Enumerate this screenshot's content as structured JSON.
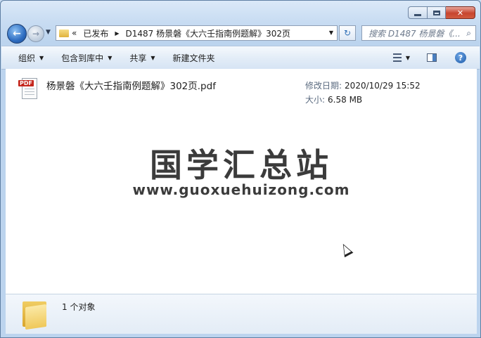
{
  "nav": {
    "breadcrumb": [
      "«",
      "已发布",
      "D1487 杨景磐《大六壬指南例题解》302页"
    ],
    "search_placeholder": "搜索 D1487 杨景磐《..."
  },
  "toolbar": {
    "organize": "组织",
    "include_in_library": "包含到库中",
    "share": "共享",
    "new_folder": "新建文件夹"
  },
  "file": {
    "name": "杨景磐《大六壬指南例题解》302页.pdf",
    "icon_tag": "PDF",
    "modified_label": "修改日期:",
    "modified_value": "2020/10/29 15:52",
    "size_label": "大小:",
    "size_value": "6.58 MB"
  },
  "watermark": {
    "title": "国学汇总站",
    "url": "www.guoxuehuizong.com"
  },
  "status": {
    "count": "1 个对象"
  }
}
